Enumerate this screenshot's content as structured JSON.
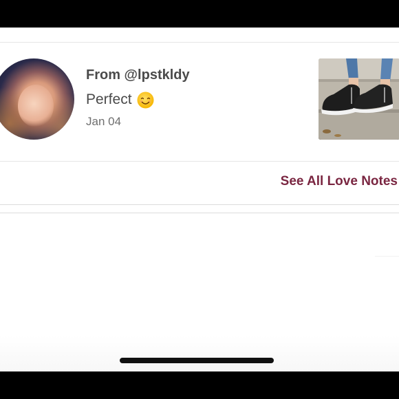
{
  "love_note": {
    "from": "From @lpstkldy",
    "message": "Perfect",
    "emoji": "smiling-face-emoji",
    "date": "Jan 04",
    "avatar": "user-avatar",
    "thumbnail": "black-slip-on-sneakers-photo"
  },
  "see_all_label": "See All Love Notes",
  "colors": {
    "accent": "#7a2641",
    "text_primary": "#4a4a4a",
    "text_secondary": "#6f6f6f",
    "letterbox": "#000000"
  }
}
